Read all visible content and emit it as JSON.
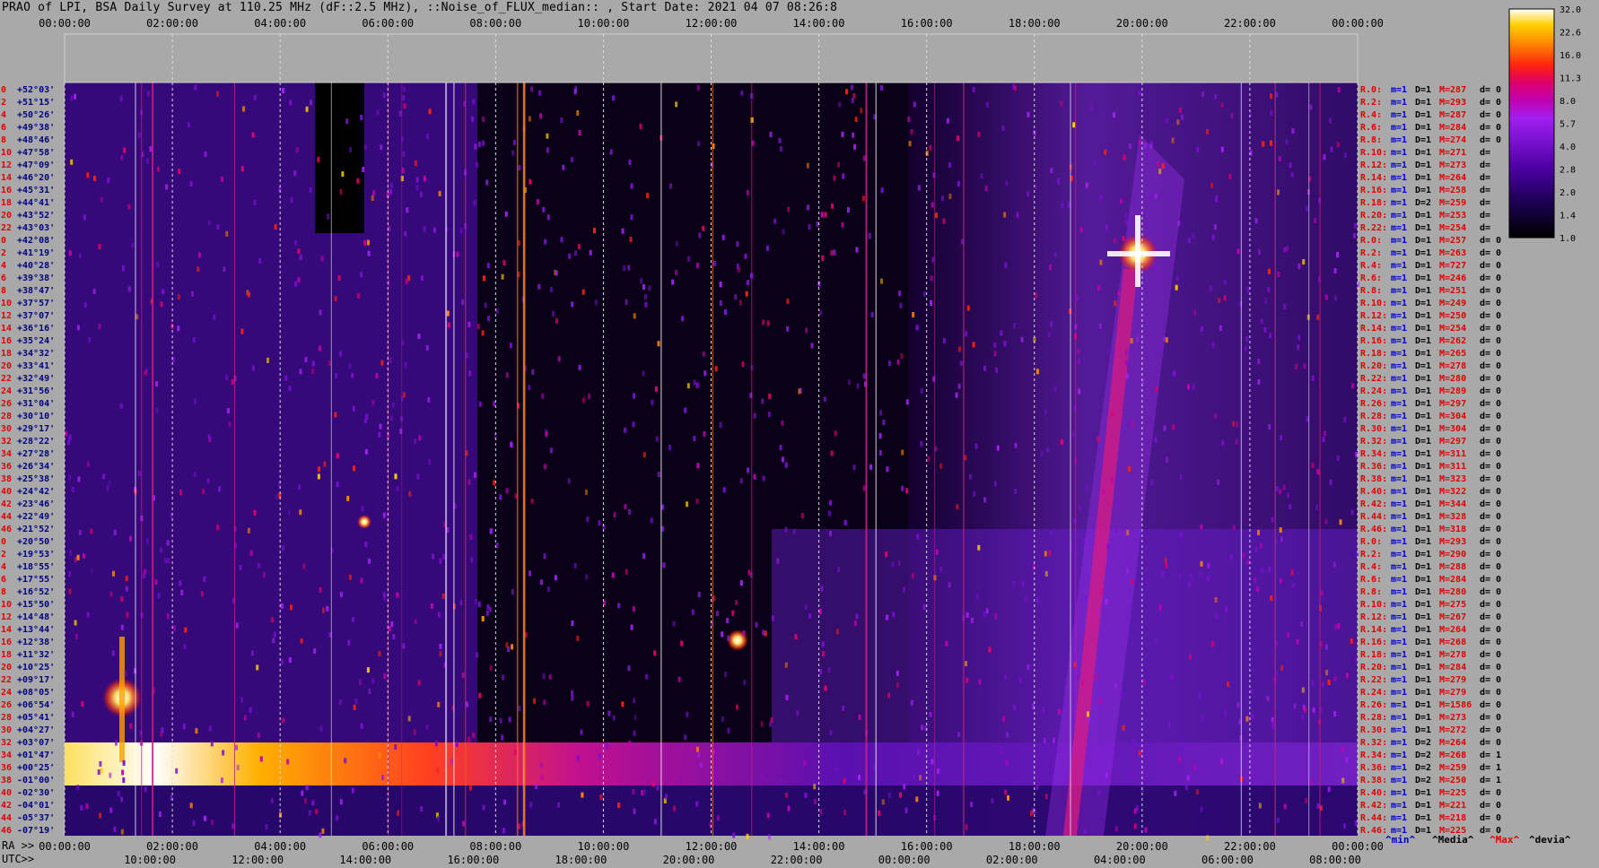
{
  "title": "PRAO of LPI, BSA Daily Survey at 110.25 MHz (dF::2.5 MHz), ::Noise_of_FLUX_median:: , Start Date: 2021 04 07 08:26:8",
  "top_time_labels": [
    "00:00:00",
    "02:00:00",
    "04:00:00",
    "06:00:00",
    "08:00:00",
    "10:00:00",
    "12:00:00",
    "14:00:00",
    "16:00:00",
    "18:00:00",
    "20:00:00",
    "22:00:00",
    "00:00:00"
  ],
  "ra_axis_prefix": "RA >>",
  "ra_time_labels": [
    "00:00:00",
    "02:00:00",
    "04:00:00",
    "06:00:00",
    "08:00:00",
    "10:00:00",
    "12:00:00",
    "14:00:00",
    "16:00:00",
    "18:00:00",
    "20:00:00",
    "22:00:00",
    "00:00:00"
  ],
  "utc_axis_prefix": "UTC>>",
  "utc_time_labels": [
    "10:00:00",
    "12:00:00",
    "14:00:00",
    "16:00:00",
    "18:00:00",
    "20:00:00",
    "22:00:00",
    "00:00:00",
    "02:00:00",
    "04:00:00",
    "06:00:00",
    "08:00:00"
  ],
  "legend_keys": [
    {
      "text": "^min^",
      "color": "#0000cc"
    },
    {
      "text": "^Media^",
      "color": "#000000"
    },
    {
      "text": "^Max^",
      "color": "#e00000"
    },
    {
      "text": "^devia^",
      "color": "#000000"
    }
  ],
  "colorbar_ticks": [
    "32.0",
    "22.6",
    "16.0",
    "11.3",
    "8.0",
    "5.7",
    "4.0",
    "2.8",
    "2.0",
    "1.4",
    "1.0"
  ],
  "colors": {
    "background": "#a9a9a9",
    "left_index": "#e00000",
    "declination": "#000080",
    "stat_m": "#0000cc",
    "stat_M": "#e00000",
    "stat_R": "#e00000"
  },
  "rows": [
    {
      "idx": "0",
      "dec": "+52°03'",
      "r": "R.0:",
      "m": "m=1",
      "D": "D=1",
      "M": "M=287",
      "d": "d= 0"
    },
    {
      "idx": "2",
      "dec": "+51°15'",
      "r": "R.2:",
      "m": "m=1",
      "D": "D=1",
      "M": "M=293",
      "d": "d= 0"
    },
    {
      "idx": "4",
      "dec": "+50°26'",
      "r": "R.4:",
      "m": "m=1",
      "D": "D=1",
      "M": "M=287",
      "d": "d= 0"
    },
    {
      "idx": "6",
      "dec": "+49°38'",
      "r": "R.6:",
      "m": "m=1",
      "D": "D=1",
      "M": "M=284",
      "d": "d= 0"
    },
    {
      "idx": "8",
      "dec": "+48°46'",
      "r": "R.8:",
      "m": "m=1",
      "D": "D=1",
      "M": "M=274",
      "d": "d= 0"
    },
    {
      "idx": "10",
      "dec": "+47°58'",
      "r": "R.10:",
      "m": "m=1",
      "D": "D=1",
      "M": "M=271",
      "d": "d="
    },
    {
      "idx": "12",
      "dec": "+47°09'",
      "r": "R.12:",
      "m": "m=1",
      "D": "D=1",
      "M": "M=273",
      "d": "d="
    },
    {
      "idx": "14",
      "dec": "+46°20'",
      "r": "R.14:",
      "m": "m=1",
      "D": "D=1",
      "M": "M=264",
      "d": "d="
    },
    {
      "idx": "16",
      "dec": "+45°31'",
      "r": "R.16:",
      "m": "m=1",
      "D": "D=1",
      "M": "M=258",
      "d": "d="
    },
    {
      "idx": "18",
      "dec": "+44°41'",
      "r": "R.18:",
      "m": "m=1",
      "D": "D=2",
      "M": "M=259",
      "d": "d="
    },
    {
      "idx": "20",
      "dec": "+43°52'",
      "r": "R.20:",
      "m": "m=1",
      "D": "D=1",
      "M": "M=253",
      "d": "d="
    },
    {
      "idx": "22",
      "dec": "+43°03'",
      "r": "R.22:",
      "m": "m=1",
      "D": "D=1",
      "M": "M=254",
      "d": "d="
    },
    {
      "idx": "0",
      "dec": "+42°08'",
      "r": "R.0:",
      "m": "m=1",
      "D": "D=1",
      "M": "M=257",
      "d": "d= 0"
    },
    {
      "idx": "2",
      "dec": "+41°19'",
      "r": "R.2:",
      "m": "m=1",
      "D": "D=1",
      "M": "M=263",
      "d": "d= 0"
    },
    {
      "idx": "4",
      "dec": "+40°28'",
      "r": "R.4:",
      "m": "m=1",
      "D": "D=1",
      "M": "M=727",
      "d": "d= 0"
    },
    {
      "idx": "6",
      "dec": "+39°38'",
      "r": "R.6:",
      "m": "m=1",
      "D": "D=1",
      "M": "M=246",
      "d": "d= 0"
    },
    {
      "idx": "8",
      "dec": "+38°47'",
      "r": "R.8:",
      "m": "m=1",
      "D": "D=1",
      "M": "M=251",
      "d": "d= 0"
    },
    {
      "idx": "10",
      "dec": "+37°57'",
      "r": "R.10:",
      "m": "m=1",
      "D": "D=1",
      "M": "M=249",
      "d": "d= 0"
    },
    {
      "idx": "12",
      "dec": "+37°07'",
      "r": "R.12:",
      "m": "m=1",
      "D": "D=1",
      "M": "M=250",
      "d": "d= 0"
    },
    {
      "idx": "14",
      "dec": "+36°16'",
      "r": "R.14:",
      "m": "m=1",
      "D": "D=1",
      "M": "M=254",
      "d": "d= 0"
    },
    {
      "idx": "16",
      "dec": "+35°24'",
      "r": "R.16:",
      "m": "m=1",
      "D": "D=1",
      "M": "M=262",
      "d": "d= 0"
    },
    {
      "idx": "18",
      "dec": "+34°32'",
      "r": "R.18:",
      "m": "m=1",
      "D": "D=1",
      "M": "M=265",
      "d": "d= 0"
    },
    {
      "idx": "20",
      "dec": "+33°41'",
      "r": "R.20:",
      "m": "m=1",
      "D": "D=1",
      "M": "M=278",
      "d": "d= 0"
    },
    {
      "idx": "22",
      "dec": "+32°49'",
      "r": "R.22:",
      "m": "m=1",
      "D": "D=1",
      "M": "M=280",
      "d": "d= 0"
    },
    {
      "idx": "24",
      "dec": "+31°56'",
      "r": "R.24:",
      "m": "m=1",
      "D": "D=1",
      "M": "M=289",
      "d": "d= 0"
    },
    {
      "idx": "26",
      "dec": "+31°04'",
      "r": "R.26:",
      "m": "m=1",
      "D": "D=1",
      "M": "M=297",
      "d": "d= 0"
    },
    {
      "idx": "28",
      "dec": "+30°10'",
      "r": "R.28:",
      "m": "m=1",
      "D": "D=1",
      "M": "M=304",
      "d": "d= 0"
    },
    {
      "idx": "30",
      "dec": "+29°17'",
      "r": "R.30:",
      "m": "m=1",
      "D": "D=1",
      "M": "M=304",
      "d": "d= 0"
    },
    {
      "idx": "32",
      "dec": "+28°22'",
      "r": "R.32:",
      "m": "m=1",
      "D": "D=1",
      "M": "M=297",
      "d": "d= 0"
    },
    {
      "idx": "34",
      "dec": "+27°28'",
      "r": "R.34:",
      "m": "m=1",
      "D": "D=1",
      "M": "M=311",
      "d": "d= 0"
    },
    {
      "idx": "36",
      "dec": "+26°34'",
      "r": "R.36:",
      "m": "m=1",
      "D": "D=1",
      "M": "M=311",
      "d": "d= 0"
    },
    {
      "idx": "38",
      "dec": "+25°38'",
      "r": "R.38:",
      "m": "m=1",
      "D": "D=1",
      "M": "M=323",
      "d": "d= 0"
    },
    {
      "idx": "40",
      "dec": "+24°42'",
      "r": "R.40:",
      "m": "m=1",
      "D": "D=1",
      "M": "M=322",
      "d": "d= 0"
    },
    {
      "idx": "42",
      "dec": "+23°46'",
      "r": "R.42:",
      "m": "m=1",
      "D": "D=1",
      "M": "M=344",
      "d": "d= 0"
    },
    {
      "idx": "44",
      "dec": "+22°49'",
      "r": "R.44:",
      "m": "m=1",
      "D": "D=1",
      "M": "M=328",
      "d": "d= 0"
    },
    {
      "idx": "46",
      "dec": "+21°52'",
      "r": "R.46:",
      "m": "m=1",
      "D": "D=1",
      "M": "M=318",
      "d": "d= 0"
    },
    {
      "idx": "0",
      "dec": "+20°50'",
      "r": "R.0:",
      "m": "m=1",
      "D": "D=1",
      "M": "M=293",
      "d": "d= 0"
    },
    {
      "idx": "2",
      "dec": "+19°53'",
      "r": "R.2:",
      "m": "m=1",
      "D": "D=1",
      "M": "M=290",
      "d": "d= 0"
    },
    {
      "idx": "4",
      "dec": "+18°55'",
      "r": "R.4:",
      "m": "m=1",
      "D": "D=1",
      "M": "M=288",
      "d": "d= 0"
    },
    {
      "idx": "6",
      "dec": "+17°55'",
      "r": "R.6:",
      "m": "m=1",
      "D": "D=1",
      "M": "M=284",
      "d": "d= 0"
    },
    {
      "idx": "8",
      "dec": "+16°52'",
      "r": "R.8:",
      "m": "m=1",
      "D": "D=1",
      "M": "M=280",
      "d": "d= 0"
    },
    {
      "idx": "10",
      "dec": "+15°50'",
      "r": "R.10:",
      "m": "m=1",
      "D": "D=1",
      "M": "M=275",
      "d": "d= 0"
    },
    {
      "idx": "12",
      "dec": "+14°48'",
      "r": "R.12:",
      "m": "m=1",
      "D": "D=1",
      "M": "M=267",
      "d": "d= 0"
    },
    {
      "idx": "14",
      "dec": "+13°44'",
      "r": "R.14:",
      "m": "m=1",
      "D": "D=1",
      "M": "M=264",
      "d": "d= 0"
    },
    {
      "idx": "16",
      "dec": "+12°38'",
      "r": "R.16:",
      "m": "m=1",
      "D": "D=1",
      "M": "M=268",
      "d": "d= 0"
    },
    {
      "idx": "18",
      "dec": "+11°32'",
      "r": "R.18:",
      "m": "m=1",
      "D": "D=1",
      "M": "M=278",
      "d": "d= 0"
    },
    {
      "idx": "20",
      "dec": "+10°25'",
      "r": "R.20:",
      "m": "m=1",
      "D": "D=1",
      "M": "M=284",
      "d": "d= 0"
    },
    {
      "idx": "22",
      "dec": "+09°17'",
      "r": "R.22:",
      "m": "m=1",
      "D": "D=1",
      "M": "M=279",
      "d": "d= 0"
    },
    {
      "idx": "24",
      "dec": "+08°05'",
      "r": "R.24:",
      "m": "m=1",
      "D": "D=1",
      "M": "M=279",
      "d": "d= 0"
    },
    {
      "idx": "26",
      "dec": "+06°54'",
      "r": "R.26:",
      "m": "m=1",
      "D": "D=1",
      "M": "M=1586",
      "d": "d= 0"
    },
    {
      "idx": "28",
      "dec": "+05°41'",
      "r": "R.28:",
      "m": "m=1",
      "D": "D=1",
      "M": "M=273",
      "d": "d= 0"
    },
    {
      "idx": "30",
      "dec": "+04°27'",
      "r": "R.30:",
      "m": "m=1",
      "D": "D=1",
      "M": "M=272",
      "d": "d= 0"
    },
    {
      "idx": "32",
      "dec": "+03°07'",
      "r": "R.32:",
      "m": "m=1",
      "D": "D=2",
      "M": "M=264",
      "d": "d= 0"
    },
    {
      "idx": "34",
      "dec": "+01°47'",
      "r": "R.34:",
      "m": "m=1",
      "D": "D=2",
      "M": "M=268",
      "d": "d= 1"
    },
    {
      "idx": "36",
      "dec": "+00°25'",
      "r": "R.36:",
      "m": "m=1",
      "D": "D=2",
      "M": "M=259",
      "d": "d= 1"
    },
    {
      "idx": "38",
      "dec": "-01°00'",
      "r": "R.38:",
      "m": "m=1",
      "D": "D=2",
      "M": "M=250",
      "d": "d= 1"
    },
    {
      "idx": "40",
      "dec": "-02°30'",
      "r": "R.40:",
      "m": "m=1",
      "D": "D=1",
      "M": "M=225",
      "d": "d= 0"
    },
    {
      "idx": "42",
      "dec": "-04°01'",
      "r": "R.42:",
      "m": "m=1",
      "D": "D=1",
      "M": "M=221",
      "d": "d= 0"
    },
    {
      "idx": "44",
      "dec": "-05°37'",
      "r": "R.44:",
      "m": "m=1",
      "D": "D=1",
      "M": "M=218",
      "d": "d= 0"
    },
    {
      "idx": "46",
      "dec": "-07°19'",
      "r": "R.46:",
      "m": "m=1",
      "D": "D=1",
      "M": "M=225",
      "d": "d= 0"
    }
  ],
  "chart_data": {
    "type": "heatmap",
    "title": "PRAO of LPI, BSA Daily Survey at 110.25 MHz (dF::2.5 MHz), ::Noise_of_FLUX_median:: , Start Date: 2021 04 07 08:26:8",
    "x_axis": "RA / UTC time, 00:00:00 to 24:00:00 (2-hour ticks)",
    "y_axis": "declination rows +52°03' to -07°19'",
    "colorbar": {
      "ticks": [
        32.0,
        22.6,
        16.0,
        11.3,
        8.0,
        5.7,
        4.0,
        2.8,
        2.0,
        1.4,
        1.0
      ],
      "scale": "log",
      "colormap": [
        "#000000",
        "#1a0050",
        "#4a00a0",
        "#7a10d0",
        "#a020f0",
        "#c000b0",
        "#e0006a",
        "#ff2010",
        "#ff8800",
        "#ffd000",
        "#ffffff"
      ]
    },
    "intensity_features": [
      {
        "feature": "bright horizontal band",
        "dec_range": [
          "+01°47'",
          "-02°30'"
        ],
        "ra_range": [
          "00:00:00",
          "08:00:00"
        ],
        "peak": 32.0
      },
      {
        "feature": "bright source",
        "ra": "01:00:00",
        "dec": "+06°54'",
        "peak": 32.0
      },
      {
        "feature": "bright source",
        "ra": "20:00:00",
        "dec": "+40°28'",
        "peak": 32.0
      },
      {
        "feature": "bright source",
        "ra": "12:30:00",
        "dec": "+12°38'",
        "peak": 22.6
      },
      {
        "feature": "diagonal ridge",
        "ra_range": [
          "18:40:00",
          "20:00:00"
        ],
        "dec_range": [
          "-07°19'",
          "+52°03'"
        ],
        "peak": 8.0
      },
      {
        "feature": "data gap",
        "ra_range": [
          "04:40:00",
          "05:40:00"
        ],
        "dec_range": [
          "+52°03'",
          "+43°03'"
        ],
        "value": 0
      }
    ]
  }
}
